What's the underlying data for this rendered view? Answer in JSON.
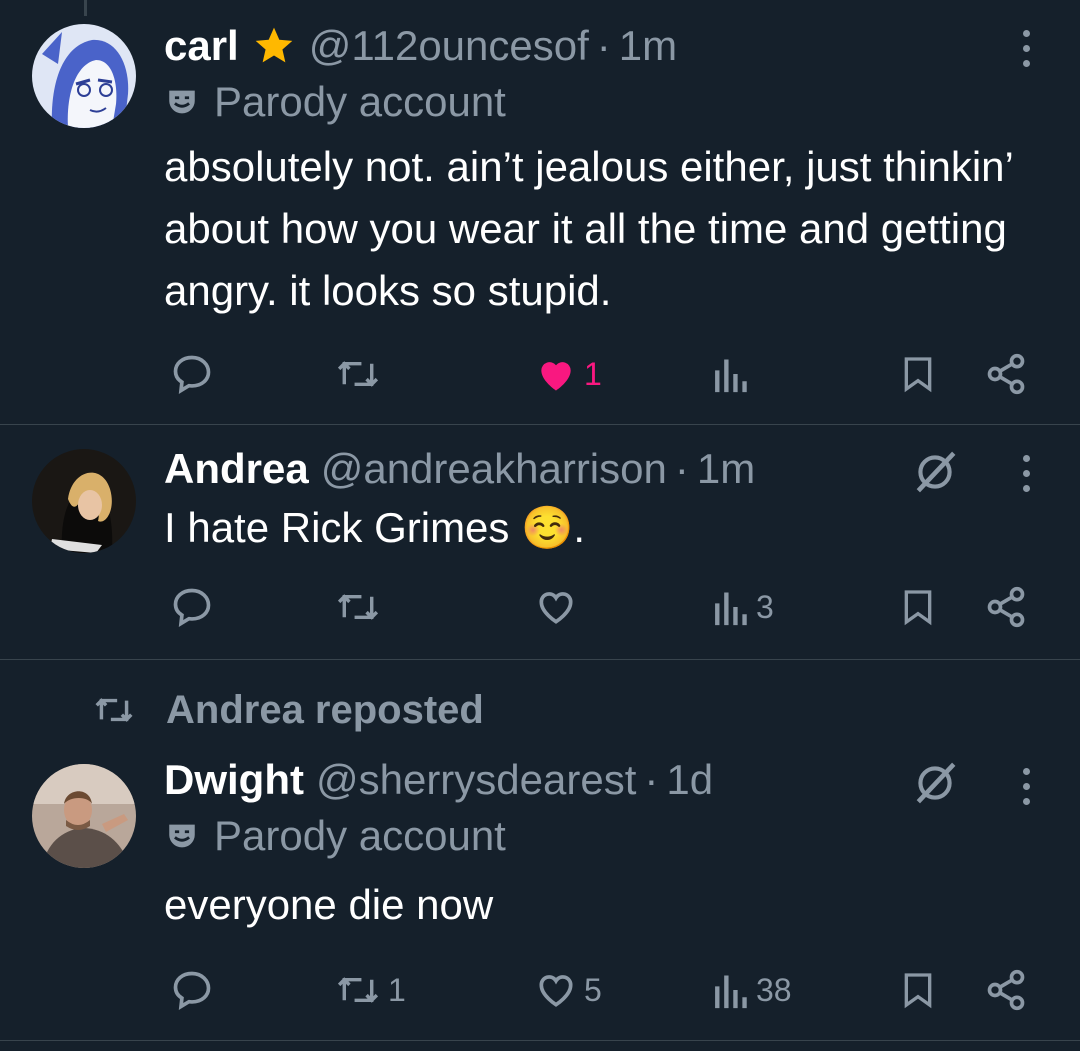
{
  "tweets": [
    {
      "name": "carl",
      "handle": "@112ouncesof",
      "separator": "·",
      "time": "1m",
      "parody_label": "Parody account",
      "text": "absolutely not. ain’t jealous either, just thinkin’ about how you wear it all the time and getting angry. it looks so stupid.",
      "replies": "",
      "reposts": "",
      "likes": "1",
      "liked": true,
      "views": ""
    },
    {
      "name": "Andrea",
      "handle": "@andreakharrison",
      "separator": "·",
      "time": "1m",
      "text": "I hate Rick Grimes ☺️.",
      "replies": "",
      "reposts": "",
      "likes": "",
      "views": "3"
    },
    {
      "repost_label": "Andrea reposted",
      "name": "Dwight",
      "handle": "@sherrysdearest",
      "separator": "·",
      "time": "1d",
      "parody_label": "Parody account",
      "text": "everyone die now",
      "replies": "",
      "reposts": "1",
      "likes": "5",
      "views": "38"
    }
  ],
  "icons": {
    "reply": "speech-bubble-icon",
    "repost": "repost-arrows-icon",
    "like": "heart-icon",
    "views": "bar-chart-icon",
    "bookmark": "bookmark-icon",
    "share": "share-nodes-icon",
    "more": "vertical-ellipsis-icon",
    "grok": "grok-slash-icon",
    "parody": "theater-mask-icon",
    "star": "star-icon"
  },
  "colors": {
    "background": "#15202b",
    "muted": "#8b98a5",
    "like_active": "#f91880",
    "star": "#ffb800"
  }
}
